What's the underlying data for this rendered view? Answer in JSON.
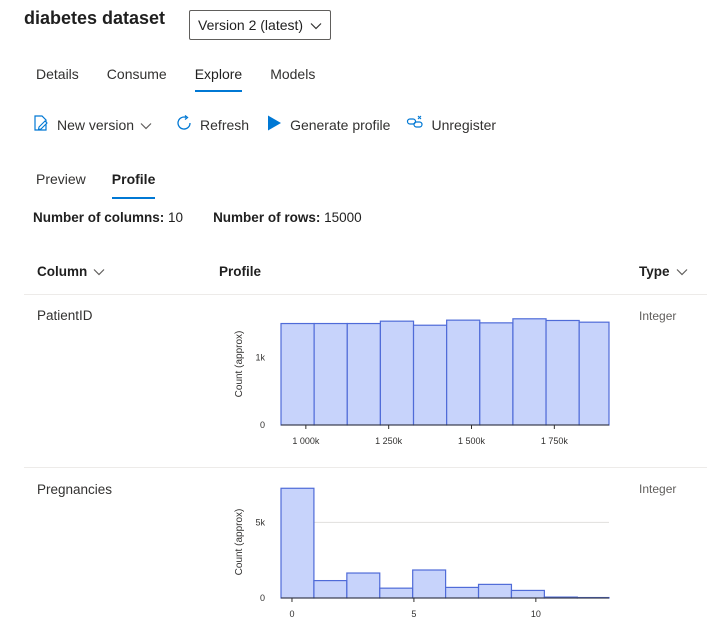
{
  "header": {
    "title": "diabetes dataset",
    "version_select": "Version 2 (latest)"
  },
  "tabs": [
    "Details",
    "Consume",
    "Explore",
    "Models"
  ],
  "active_tab": "Explore",
  "toolbar": {
    "new_version": "New version",
    "refresh": "Refresh",
    "generate_profile": "Generate profile",
    "unregister": "Unregister"
  },
  "subtabs": [
    "Preview",
    "Profile"
  ],
  "active_subtab": "Profile",
  "stats": {
    "columns_label": "Number of columns:",
    "columns_value": "10",
    "rows_label": "Number of rows:",
    "rows_value": "15000"
  },
  "table": {
    "headers": {
      "column": "Column",
      "profile": "Profile",
      "type": "Type"
    },
    "rows": [
      {
        "name": "PatientID",
        "type": "Integer"
      },
      {
        "name": "Pregnancies",
        "type": "Integer"
      }
    ]
  },
  "colors": {
    "accent": "#0078d4",
    "bar_fill": "#c7d3fb",
    "bar_stroke": "#4f6bd8"
  },
  "chart_data": [
    {
      "type": "bar",
      "ylabel": "Count (approx)",
      "ylim": [
        0,
        1700
      ],
      "yticks": [
        {
          "v": 0,
          "label": "0"
        },
        {
          "v": 1000,
          "label": "1k"
        }
      ],
      "xlim": [
        925000,
        1915000
      ],
      "xticks": [
        {
          "v": 1000000,
          "label": "1 000k"
        },
        {
          "v": 1250000,
          "label": "1 250k"
        },
        {
          "v": 1500000,
          "label": "1 500k"
        },
        {
          "v": 1750000,
          "label": "1 750k"
        }
      ],
      "bins": [
        {
          "x0": 925000,
          "x1": 1025000,
          "value": 1500
        },
        {
          "x0": 1025000,
          "x1": 1125000,
          "value": 1500
        },
        {
          "x0": 1125000,
          "x1": 1225000,
          "value": 1500
        },
        {
          "x0": 1225000,
          "x1": 1325000,
          "value": 1535
        },
        {
          "x0": 1325000,
          "x1": 1425000,
          "value": 1475
        },
        {
          "x0": 1425000,
          "x1": 1525000,
          "value": 1550
        },
        {
          "x0": 1525000,
          "x1": 1625000,
          "value": 1510
        },
        {
          "x0": 1625000,
          "x1": 1725000,
          "value": 1570
        },
        {
          "x0": 1725000,
          "x1": 1825000,
          "value": 1545
        },
        {
          "x0": 1825000,
          "x1": 1915000,
          "value": 1520
        }
      ]
    },
    {
      "type": "bar",
      "ylabel": "Count (approx)",
      "ylim": [
        0,
        7400
      ],
      "yticks": [
        {
          "v": 0,
          "label": "0"
        },
        {
          "v": 5000,
          "label": "5k"
        }
      ],
      "xlim": [
        -0.45,
        13
      ],
      "xticks": [
        {
          "v": 0,
          "label": "0"
        },
        {
          "v": 5,
          "label": "5"
        },
        {
          "v": 10,
          "label": "10"
        }
      ],
      "bins": [
        {
          "x0": -0.45,
          "x1": 0.9,
          "value": 7250
        },
        {
          "x0": 0.9,
          "x1": 2.25,
          "value": 1150
        },
        {
          "x0": 2.25,
          "x1": 3.6,
          "value": 1650
        },
        {
          "x0": 3.6,
          "x1": 4.95,
          "value": 650
        },
        {
          "x0": 4.95,
          "x1": 6.3,
          "value": 1850
        },
        {
          "x0": 6.3,
          "x1": 7.65,
          "value": 700
        },
        {
          "x0": 7.65,
          "x1": 9.0,
          "value": 900
        },
        {
          "x0": 9.0,
          "x1": 10.35,
          "value": 500
        },
        {
          "x0": 10.35,
          "x1": 11.7,
          "value": 60
        },
        {
          "x0": 11.7,
          "x1": 13.0,
          "value": 30
        }
      ]
    }
  ]
}
